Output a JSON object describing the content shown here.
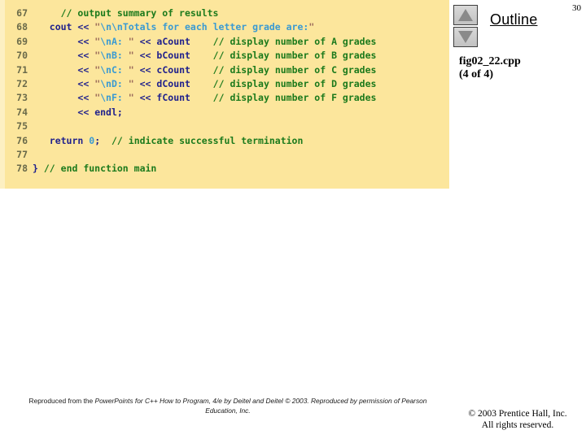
{
  "code_panel": {
    "background_color": "#fce69c",
    "lines": [
      {
        "number": "67",
        "indent": 5,
        "tokens": [
          {
            "t": "cm",
            "s": "// output summary of results"
          }
        ]
      },
      {
        "number": "68",
        "indent": 3,
        "tokens": [
          {
            "t": "kw",
            "s": "cout"
          },
          {
            "t": "plain",
            "s": " "
          },
          {
            "t": "op",
            "s": "<<"
          },
          {
            "t": "plain",
            "s": " "
          },
          {
            "t": "qt",
            "s": "\""
          },
          {
            "t": "st",
            "s": "\\n\\nTotals for each letter grade are:"
          },
          {
            "t": "qt",
            "s": "\""
          }
        ]
      },
      {
        "number": "69",
        "indent": 8,
        "tokens": [
          {
            "t": "op",
            "s": "<<"
          },
          {
            "t": "plain",
            "s": " "
          },
          {
            "t": "qt",
            "s": "\""
          },
          {
            "t": "st",
            "s": "\\nA: "
          },
          {
            "t": "qt",
            "s": "\""
          },
          {
            "t": "plain",
            "s": " "
          },
          {
            "t": "op",
            "s": "<<"
          },
          {
            "t": "plain",
            "s": " "
          },
          {
            "t": "kw",
            "s": "aCount"
          },
          {
            "t": "plain",
            "s": "    "
          },
          {
            "t": "cm",
            "s": "// display number of A grades"
          }
        ]
      },
      {
        "number": "70",
        "indent": 8,
        "tokens": [
          {
            "t": "op",
            "s": "<<"
          },
          {
            "t": "plain",
            "s": " "
          },
          {
            "t": "qt",
            "s": "\""
          },
          {
            "t": "st",
            "s": "\\nB: "
          },
          {
            "t": "qt",
            "s": "\""
          },
          {
            "t": "plain",
            "s": " "
          },
          {
            "t": "op",
            "s": "<<"
          },
          {
            "t": "plain",
            "s": " "
          },
          {
            "t": "kw",
            "s": "bCount"
          },
          {
            "t": "plain",
            "s": "    "
          },
          {
            "t": "cm",
            "s": "// display number of B grades"
          }
        ]
      },
      {
        "number": "71",
        "indent": 8,
        "tokens": [
          {
            "t": "op",
            "s": "<<"
          },
          {
            "t": "plain",
            "s": " "
          },
          {
            "t": "qt",
            "s": "\""
          },
          {
            "t": "st",
            "s": "\\nC: "
          },
          {
            "t": "qt",
            "s": "\""
          },
          {
            "t": "plain",
            "s": " "
          },
          {
            "t": "op",
            "s": "<<"
          },
          {
            "t": "plain",
            "s": " "
          },
          {
            "t": "kw",
            "s": "cCount"
          },
          {
            "t": "plain",
            "s": "    "
          },
          {
            "t": "cm",
            "s": "// display number of C grades"
          }
        ]
      },
      {
        "number": "72",
        "indent": 8,
        "tokens": [
          {
            "t": "op",
            "s": "<<"
          },
          {
            "t": "plain",
            "s": " "
          },
          {
            "t": "qt",
            "s": "\""
          },
          {
            "t": "st",
            "s": "\\nD: "
          },
          {
            "t": "qt",
            "s": "\""
          },
          {
            "t": "plain",
            "s": " "
          },
          {
            "t": "op",
            "s": "<<"
          },
          {
            "t": "plain",
            "s": " "
          },
          {
            "t": "kw",
            "s": "dCount"
          },
          {
            "t": "plain",
            "s": "    "
          },
          {
            "t": "cm",
            "s": "// display number of D grades"
          }
        ]
      },
      {
        "number": "73",
        "indent": 8,
        "tokens": [
          {
            "t": "op",
            "s": "<<"
          },
          {
            "t": "plain",
            "s": " "
          },
          {
            "t": "qt",
            "s": "\""
          },
          {
            "t": "st",
            "s": "\\nF: "
          },
          {
            "t": "qt",
            "s": "\""
          },
          {
            "t": "plain",
            "s": " "
          },
          {
            "t": "op",
            "s": "<<"
          },
          {
            "t": "plain",
            "s": " "
          },
          {
            "t": "kw",
            "s": "fCount"
          },
          {
            "t": "plain",
            "s": "    "
          },
          {
            "t": "cm",
            "s": "// display number of F grades"
          }
        ]
      },
      {
        "number": "74",
        "indent": 8,
        "tokens": [
          {
            "t": "op",
            "s": "<<"
          },
          {
            "t": "plain",
            "s": " "
          },
          {
            "t": "kw",
            "s": "endl;"
          }
        ]
      },
      {
        "number": "75",
        "indent": 0,
        "tokens": []
      },
      {
        "number": "76",
        "indent": 3,
        "tokens": [
          {
            "t": "kw",
            "s": "return"
          },
          {
            "t": "plain",
            "s": " "
          },
          {
            "t": "num",
            "s": "0"
          },
          {
            "t": "kw",
            "s": ";"
          },
          {
            "t": "plain",
            "s": "  "
          },
          {
            "t": "cm",
            "s": "// indicate successful termination"
          }
        ]
      },
      {
        "number": "77",
        "indent": 0,
        "tokens": []
      },
      {
        "number": "78",
        "indent": 0,
        "tokens": [
          {
            "t": "kw",
            "s": "}"
          },
          {
            "t": "plain",
            "s": " "
          },
          {
            "t": "cm",
            "s": "// end function main"
          }
        ]
      }
    ]
  },
  "outline": {
    "title": "Outline",
    "page_number": "30",
    "nav_up_icon": "triangle-up-icon",
    "nav_down_icon": "triangle-down-icon",
    "file_name": "fig02_22.cpp",
    "file_part": "(4 of 4)"
  },
  "footer": {
    "attribution_prefix": "Reproduced from the ",
    "attribution_italic": "PowerPoints for C++ How to Program, 4/e by Deitel and Deitel © 2003. Reproduced by permission of Pearson Education, Inc.",
    "copyright_line1": "© 2003 Prentice Hall, Inc.",
    "copyright_line2": "All rights reserved."
  }
}
